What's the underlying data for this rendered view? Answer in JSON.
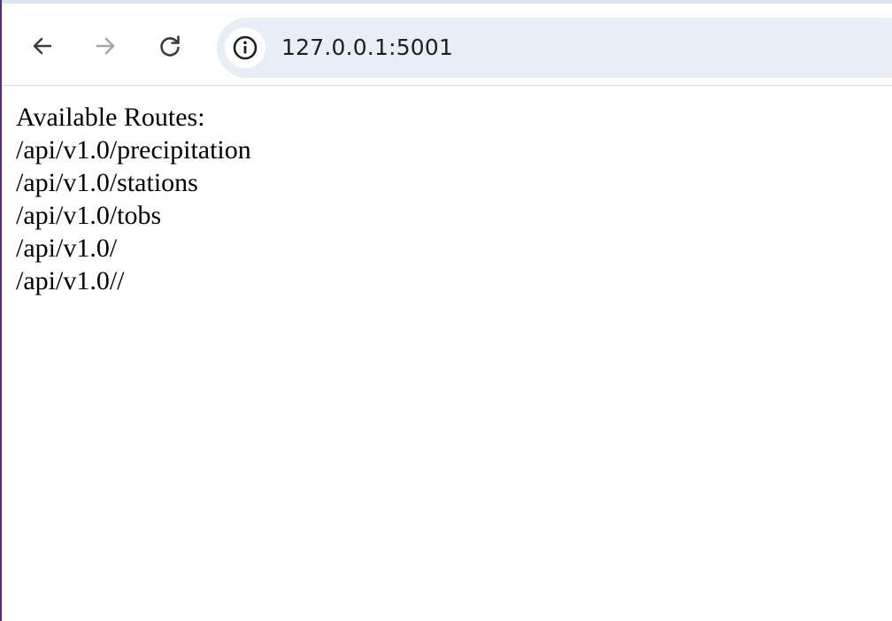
{
  "browser": {
    "address_bar": {
      "url": "127.0.0.1:5001",
      "site_info_icon": "info-icon"
    },
    "nav": {
      "back_icon": "arrow-left-icon",
      "forward_icon": "arrow-right-icon",
      "reload_icon": "reload-icon"
    }
  },
  "page": {
    "heading": "Available Routes:",
    "routes": [
      "/api/v1.0/precipitation",
      "/api/v1.0/stations",
      "/api/v1.0/tobs",
      "/api/v1.0/",
      "/api/v1.0//"
    ]
  }
}
